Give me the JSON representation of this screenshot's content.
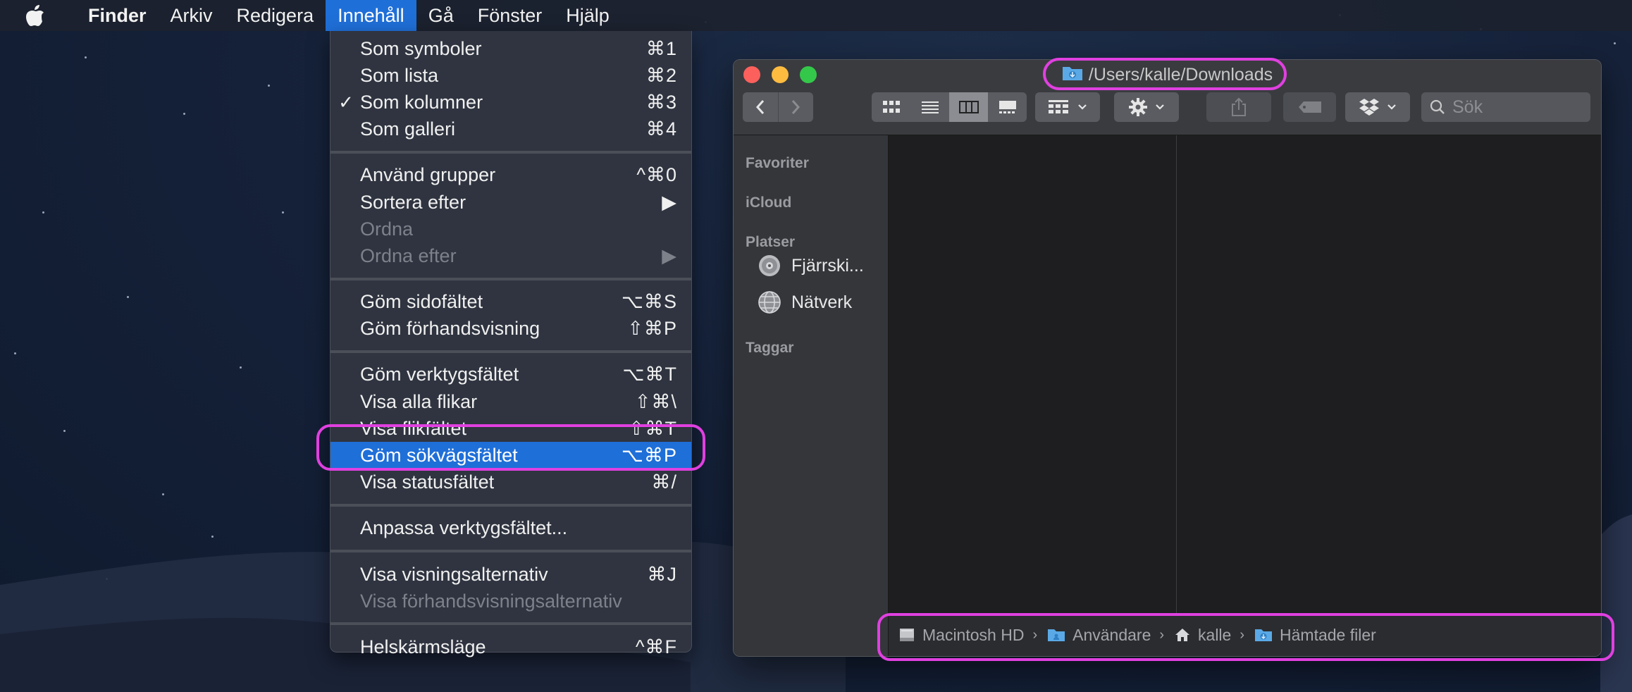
{
  "menubar": {
    "app_name": "Finder",
    "items": [
      "Arkiv",
      "Redigera",
      "Innehåll",
      "Gå",
      "Fönster",
      "Hjälp"
    ]
  },
  "menu": {
    "groups": [
      [
        {
          "label": "Som symboler",
          "shortcut": "⌘1",
          "checked": false,
          "disabled": false
        },
        {
          "label": "Som lista",
          "shortcut": "⌘2",
          "checked": false,
          "disabled": false
        },
        {
          "label": "Som kolumner",
          "shortcut": "⌘3",
          "checked": true,
          "disabled": false
        },
        {
          "label": "Som galleri",
          "shortcut": "⌘4",
          "checked": false,
          "disabled": false
        }
      ],
      [
        {
          "label": "Använd grupper",
          "shortcut": "^⌘0",
          "checked": false,
          "disabled": false
        },
        {
          "label": "Sortera efter",
          "shortcut": "▶",
          "checked": false,
          "disabled": false
        },
        {
          "label": "Ordna",
          "shortcut": "",
          "checked": false,
          "disabled": true
        },
        {
          "label": "Ordna efter",
          "shortcut": "▶",
          "checked": false,
          "disabled": true
        }
      ],
      [
        {
          "label": "Göm sidofältet",
          "shortcut": "⌥⌘S",
          "checked": false,
          "disabled": false
        },
        {
          "label": "Göm förhandsvisning",
          "shortcut": "⇧⌘P",
          "checked": false,
          "disabled": false
        }
      ],
      [
        {
          "label": "Göm verktygsfältet",
          "shortcut": "⌥⌘T",
          "checked": false,
          "disabled": false
        },
        {
          "label": "Visa alla flikar",
          "shortcut": "⇧⌘\\",
          "checked": false,
          "disabled": false
        },
        {
          "label": "Visa flikfältet",
          "shortcut": "⇧⌘T",
          "checked": false,
          "disabled": false
        },
        {
          "label": "Göm sökvägsfältet",
          "shortcut": "⌥⌘P",
          "checked": false,
          "disabled": false,
          "highlighted": true
        },
        {
          "label": "Visa statusfältet",
          "shortcut": "⌘/",
          "checked": false,
          "disabled": false
        }
      ],
      [
        {
          "label": "Anpassa verktygsfältet...",
          "shortcut": "",
          "checked": false,
          "disabled": false
        }
      ],
      [
        {
          "label": "Visa visningsalternativ",
          "shortcut": "⌘J",
          "checked": false,
          "disabled": false
        },
        {
          "label": "Visa förhandsvisningsalternativ",
          "shortcut": "",
          "checked": false,
          "disabled": true
        }
      ],
      [
        {
          "label": "Helskärmsläge",
          "shortcut": "^⌘F",
          "checked": false,
          "disabled": false
        }
      ]
    ]
  },
  "window": {
    "title": "/Users/kalle/Downloads",
    "search_placeholder": "Sök",
    "sidebar": {
      "sections": [
        "Favoriter",
        "iCloud",
        "Platser",
        "Taggar"
      ],
      "places": [
        {
          "label": "Fjärrski...",
          "icon": "remote-disc-icon"
        },
        {
          "label": "Nätverk",
          "icon": "network-globe-icon"
        }
      ]
    },
    "pathbar": [
      {
        "label": "Macintosh HD",
        "icon": "hard-drive-icon"
      },
      {
        "label": "Användare",
        "icon": "folder-users-icon"
      },
      {
        "label": "kalle",
        "icon": "home-icon"
      },
      {
        "label": "Hämtade filer",
        "icon": "downloads-folder-icon"
      }
    ]
  },
  "colors": {
    "accent": "#1f6fd8",
    "annotation": "#e040e0",
    "traffic_red": "#fc605c",
    "traffic_yellow": "#fdbc40",
    "traffic_green": "#34c84a"
  }
}
